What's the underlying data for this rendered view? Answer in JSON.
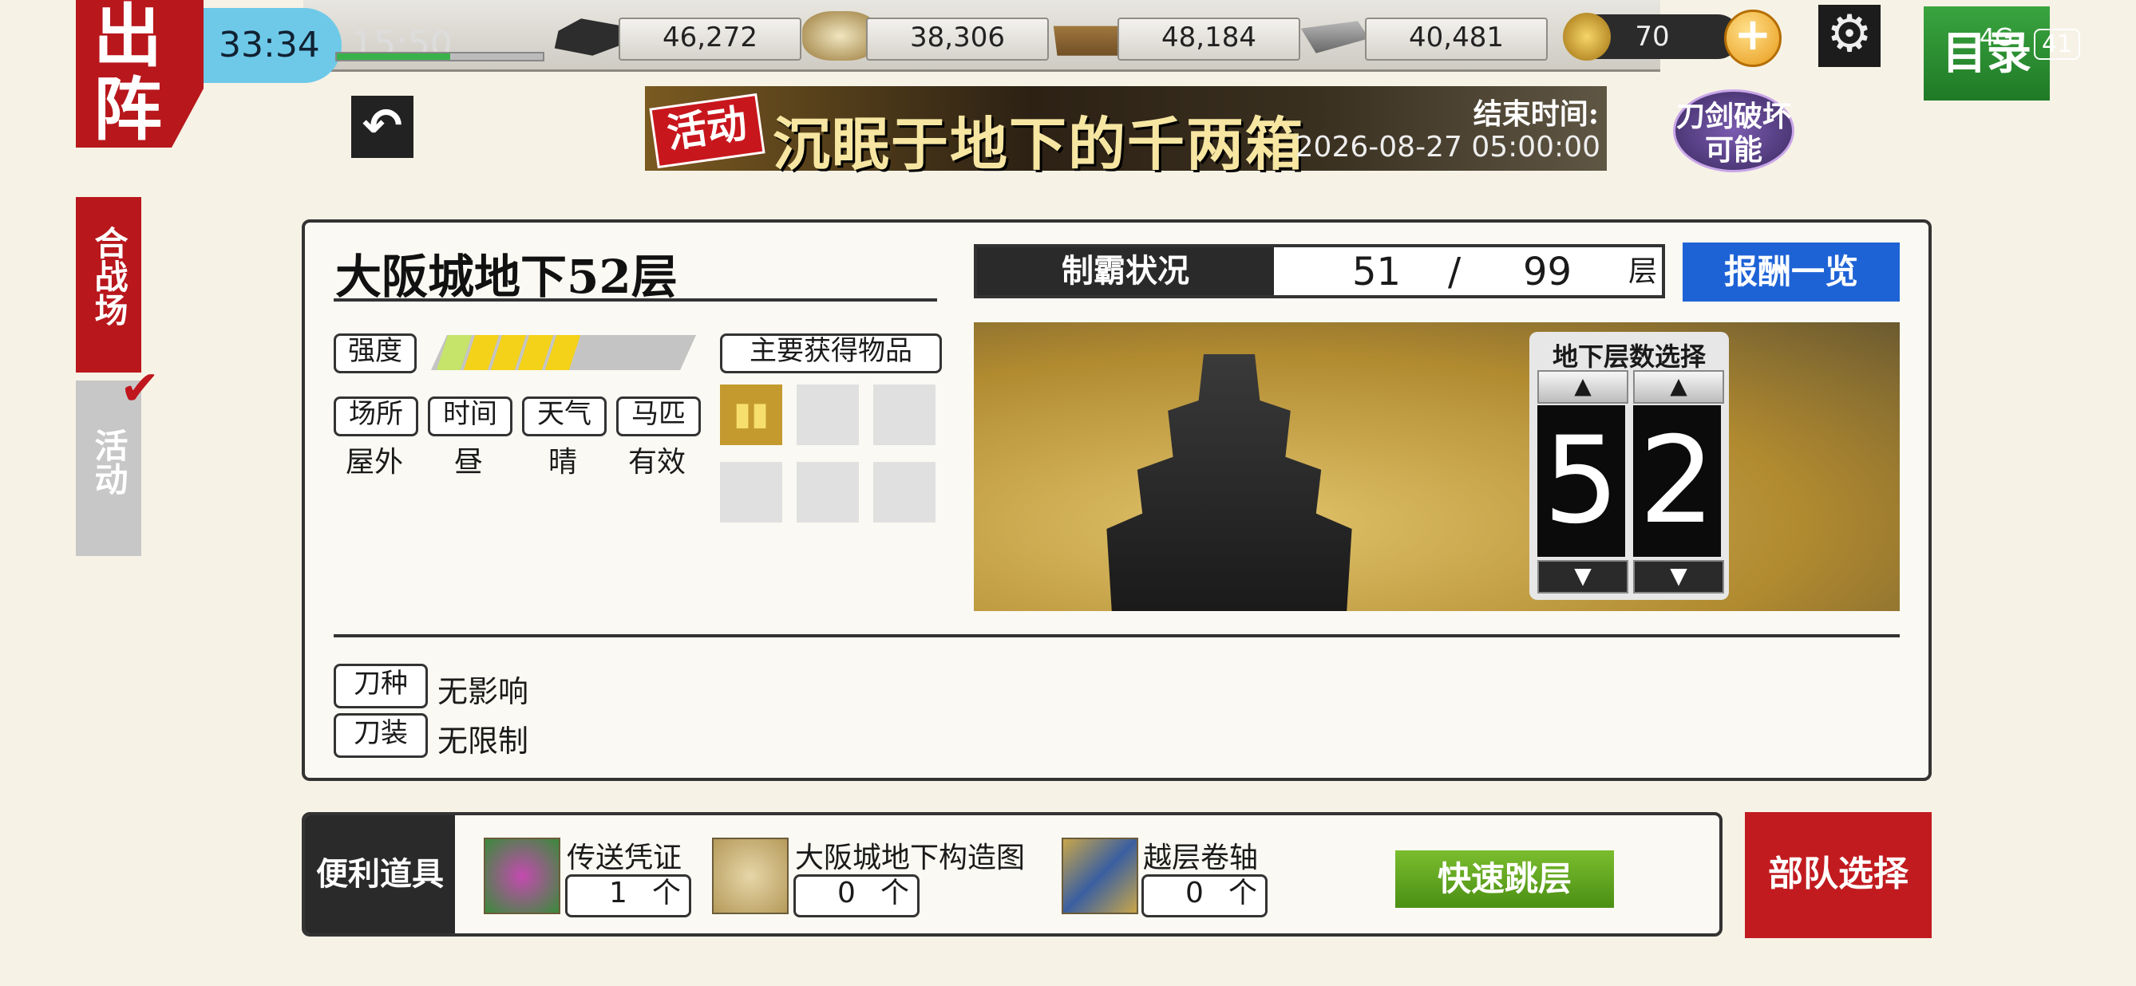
{
  "header": {
    "sortie_label": "出阵",
    "timer": "33:34",
    "clock": "15:50",
    "exp_progress": 0.55,
    "back_icon": "undo-arrow-icon",
    "resources": [
      {
        "name": "charcoal",
        "icon": "charcoal-icon",
        "value": "46,272"
      },
      {
        "name": "jewel_steel",
        "icon": "steel-icon",
        "value": "38,306"
      },
      {
        "name": "cooling_material",
        "icon": "cooling-material-icon",
        "value": "48,184"
      },
      {
        "name": "whetstone",
        "icon": "whetstone-icon",
        "value": "40,481"
      }
    ],
    "koban": "70",
    "catalog_label": "目录",
    "signal": "4G",
    "battery": "41"
  },
  "event_banner": {
    "tag": "活动",
    "title": "沉眠于地下的千两箱",
    "end_label": "结束时间:",
    "end_time": "2026-08-27 05:00:00"
  },
  "badge": {
    "line1": "刀剑破坏",
    "line2": "可能"
  },
  "side_tabs": [
    {
      "label": "合战场",
      "active": true
    },
    {
      "label": "活动",
      "active": false,
      "checked": true
    }
  ],
  "stage": {
    "title": "大阪城地下52层",
    "strength_label": "强度",
    "strength_level": 5,
    "strength_max": 10,
    "conditions": [
      {
        "label": "场所",
        "value": "屋外"
      },
      {
        "label": "时间",
        "value": "昼"
      },
      {
        "label": "天气",
        "value": "晴"
      },
      {
        "label": "马匹",
        "value": "有效"
      }
    ],
    "main_items_label": "主要获得物品",
    "blade_type_label": "刀种",
    "blade_type_value": "无影响",
    "equip_label": "刀装",
    "equip_value": "无限制"
  },
  "conquest": {
    "label": "制霸状况",
    "current": "51",
    "separator": "/",
    "total": "99",
    "unit": "层",
    "rewards_button": "报酬一览"
  },
  "floor_select": {
    "caption": "地下层数选择",
    "digits": [
      "5",
      "2"
    ],
    "up_icon": "▲",
    "down_icon": "▼"
  },
  "tools": {
    "label": "便利道具",
    "items": [
      {
        "name": "传送凭证",
        "count": "1",
        "unit": "个",
        "icon": "teleport-voucher-icon"
      },
      {
        "name": "大阪城地下构造图",
        "count": "0",
        "unit": "个",
        "icon": "map-scroll-icon"
      },
      {
        "name": "越层卷轴",
        "count": "0",
        "unit": "个",
        "icon": "skip-scroll-icon"
      }
    ],
    "quick_jump": "快速跳层"
  },
  "squad_button": "部队选择",
  "colors": {
    "red": "#b8171c",
    "blue": "#1e63d6",
    "green": "#4b8f14",
    "strength_fill": "#f4d21a",
    "strength_start": "#c6e36a"
  }
}
